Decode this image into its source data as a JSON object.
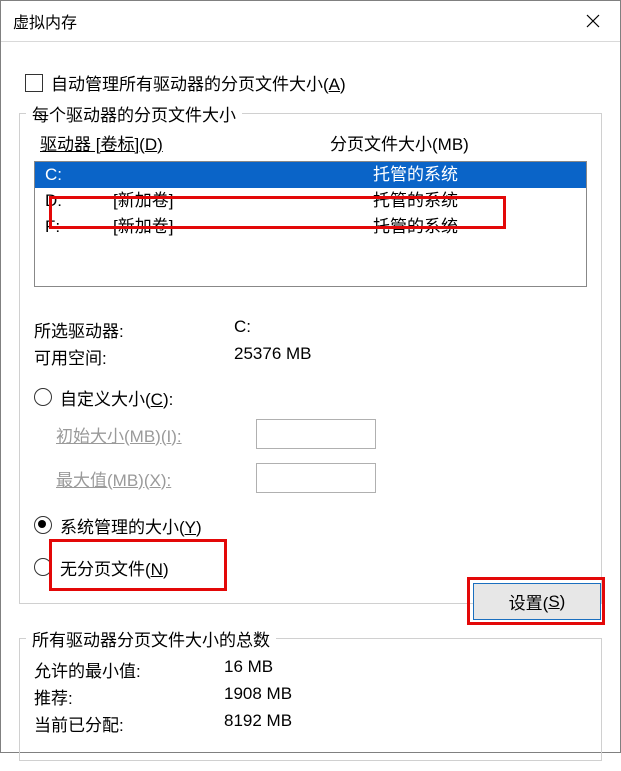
{
  "window": {
    "title": "虚拟内存"
  },
  "auto_manage": {
    "label_prefix": "自动管理所有驱动器的分页文件大小(",
    "accelerator": "A",
    "label_suffix": ")"
  },
  "group1": {
    "legend": "每个驱动器的分页文件大小",
    "header_left_prefix": "驱动器 [卷标](",
    "header_left_accel": "D",
    "header_left_suffix": ")",
    "header_right": "分页文件大小(MB)",
    "rows": [
      {
        "drive": "C:",
        "label": "",
        "size": "托管的系统",
        "selected": true
      },
      {
        "drive": "D:",
        "label": "[新加卷]",
        "size": "托管的系统",
        "selected": false
      },
      {
        "drive": "F:",
        "label": "[新加卷]",
        "size": "托管的系统",
        "selected": false
      }
    ],
    "selected_label": "所选驱动器:",
    "selected_value": "C:",
    "avail_label": "可用空间:",
    "avail_value": "25376 MB",
    "radio_custom_prefix": "自定义大小(",
    "radio_custom_accel": "C",
    "radio_custom_suffix": "):",
    "initial_label_prefix": "初始大小(MB)(",
    "initial_label_accel": "I",
    "initial_label_suffix": "):",
    "max_label_prefix": "最大值(MB)(",
    "max_label_accel": "X",
    "max_label_suffix": "):",
    "radio_system_prefix": "系统管理的大小(",
    "radio_system_accel": "Y",
    "radio_system_suffix": ")",
    "radio_none_prefix": "无分页文件(",
    "radio_none_accel": "N",
    "radio_none_suffix": ")",
    "set_button_prefix": "设置(",
    "set_button_accel": "S",
    "set_button_suffix": ")"
  },
  "group2": {
    "legend": "所有驱动器分页文件大小的总数",
    "min_label": "允许的最小值:",
    "min_value": "16 MB",
    "rec_label": "推荐:",
    "rec_value": "1908 MB",
    "cur_label": "当前已分配:",
    "cur_value": "8192 MB"
  }
}
